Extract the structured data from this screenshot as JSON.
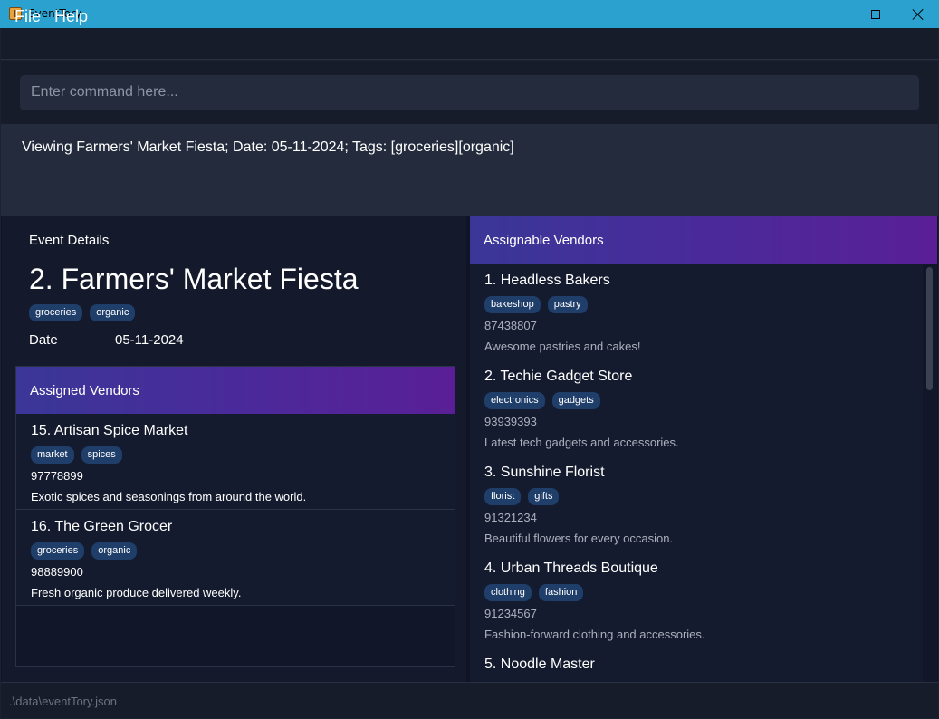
{
  "window": {
    "title": "EventTory"
  },
  "menu": {
    "file": "File",
    "help": "Help"
  },
  "command": {
    "placeholder": "Enter command here..."
  },
  "result": {
    "text": "Viewing Farmers' Market Fiesta; Date: 05-11-2024; Tags: [groceries][organic]"
  },
  "event": {
    "heading": "Event Details",
    "name": "2. Farmers' Market Fiesta",
    "tags": [
      "groceries",
      "organic"
    ],
    "date_label": "Date",
    "date_value": "05-11-2024"
  },
  "assigned": {
    "header": "Assigned Vendors",
    "vendors": [
      {
        "name": "15. Artisan Spice Market",
        "tags": [
          "market",
          "spices"
        ],
        "phone": "97778899",
        "description": "Exotic spices and seasonings from around the world."
      },
      {
        "name": "16. The Green Grocer",
        "tags": [
          "groceries",
          "organic"
        ],
        "phone": "98889900",
        "description": "Fresh organic produce delivered weekly."
      }
    ]
  },
  "assignable": {
    "header": "Assignable Vendors",
    "vendors": [
      {
        "name": "1. Headless Bakers",
        "tags": [
          "bakeshop",
          "pastry"
        ],
        "phone": "87438807",
        "description": "Awesome pastries and cakes!"
      },
      {
        "name": "2. Techie Gadget Store",
        "tags": [
          "electronics",
          "gadgets"
        ],
        "phone": "93939393",
        "description": "Latest tech gadgets and accessories."
      },
      {
        "name": "3. Sunshine Florist",
        "tags": [
          "florist",
          "gifts"
        ],
        "phone": "91321234",
        "description": "Beautiful flowers for every occasion."
      },
      {
        "name": "4. Urban Threads Boutique",
        "tags": [
          "clothing",
          "fashion"
        ],
        "phone": "91234567",
        "description": "Fashion-forward clothing and accessories."
      },
      {
        "name": "5. Noodle Master",
        "tags": [],
        "phone": "",
        "description": ""
      }
    ]
  },
  "status": {
    "path": ".\\data\\eventTory.json"
  }
}
